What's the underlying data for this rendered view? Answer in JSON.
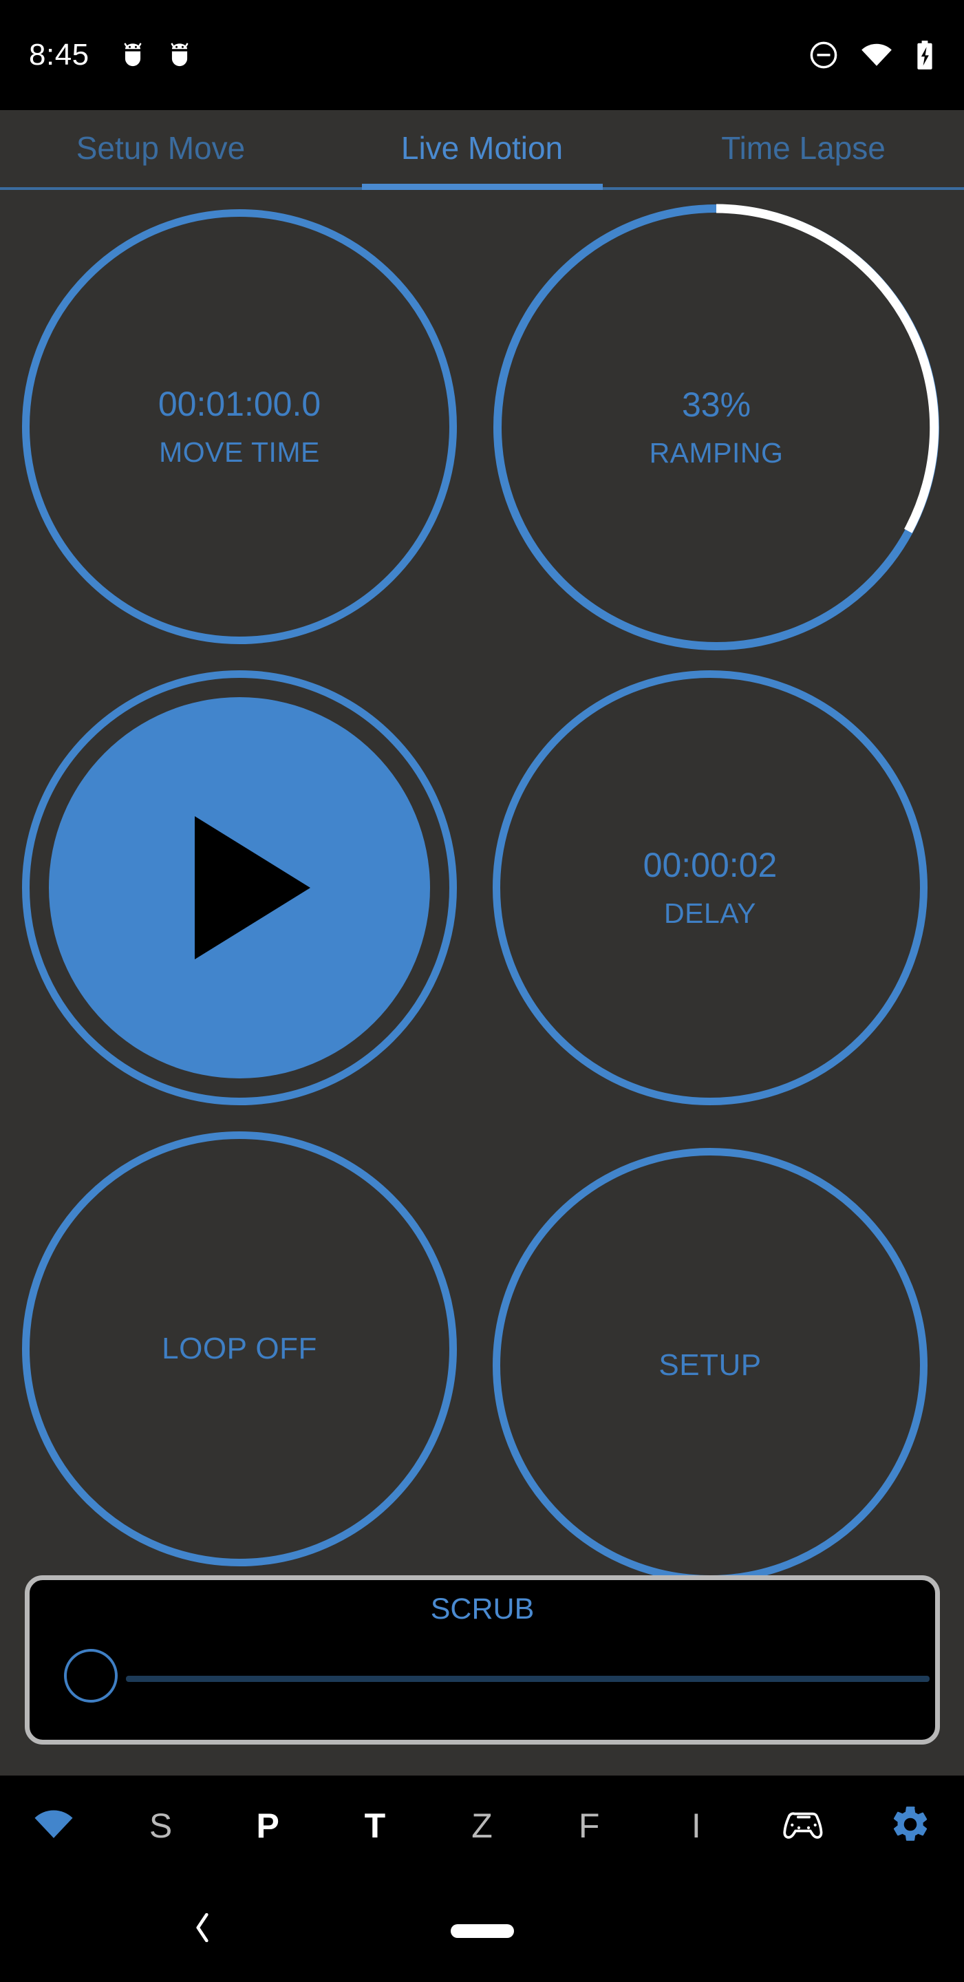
{
  "status_bar": {
    "clock": "8:45",
    "left_icons": [
      "android-notification-icon",
      "android-notification-icon"
    ],
    "right_icons": [
      "do-not-disturb-icon",
      "wifi-icon",
      "battery-charging-icon"
    ]
  },
  "tabs": [
    {
      "label": "Setup Move",
      "active": false
    },
    {
      "label": "Live Motion",
      "active": true
    },
    {
      "label": "Time Lapse",
      "active": false
    }
  ],
  "controls": {
    "move_time": {
      "value": "00:01:00.0",
      "label": "MOVE TIME"
    },
    "ramping": {
      "value": "33%",
      "label": "RAMPING",
      "percent": 33
    },
    "play": {
      "icon": "play-icon",
      "label": "PLAY"
    },
    "delay": {
      "value": "00:00:02",
      "label": "DELAY"
    },
    "loop": {
      "label": "LOOP OFF"
    },
    "setup": {
      "label": "SETUP"
    }
  },
  "scrub": {
    "title": "SCRUB",
    "value": 0,
    "min": 0,
    "max": 100
  },
  "app_nav": [
    {
      "name": "wifi",
      "icon": "wifi-icon",
      "label": "",
      "style": "accent"
    },
    {
      "name": "s",
      "icon": "",
      "label": "S",
      "style": "dim"
    },
    {
      "name": "p",
      "icon": "",
      "label": "P",
      "style": "bold"
    },
    {
      "name": "t",
      "icon": "",
      "label": "T",
      "style": "bold"
    },
    {
      "name": "z",
      "icon": "",
      "label": "Z",
      "style": "dim"
    },
    {
      "name": "f",
      "icon": "",
      "label": "F",
      "style": "dim"
    },
    {
      "name": "i",
      "icon": "",
      "label": "I",
      "style": "dim"
    },
    {
      "name": "gamepad",
      "icon": "gamepad-icon",
      "label": "",
      "style": "white"
    },
    {
      "name": "settings",
      "icon": "gear-icon",
      "label": "",
      "style": "accent"
    }
  ],
  "system_nav": {
    "back": "back-chevron-icon",
    "home": "home-pill-icon"
  },
  "colors": {
    "accent": "#4285cc",
    "accent_dim": "#3b6c9f",
    "accent_text": "#3f7fc4",
    "background": "#333230",
    "panel_background": "#000000",
    "panel_border": "#b8b8b8",
    "progress_remaining": "#ffffff",
    "track": "#1d3b58"
  }
}
